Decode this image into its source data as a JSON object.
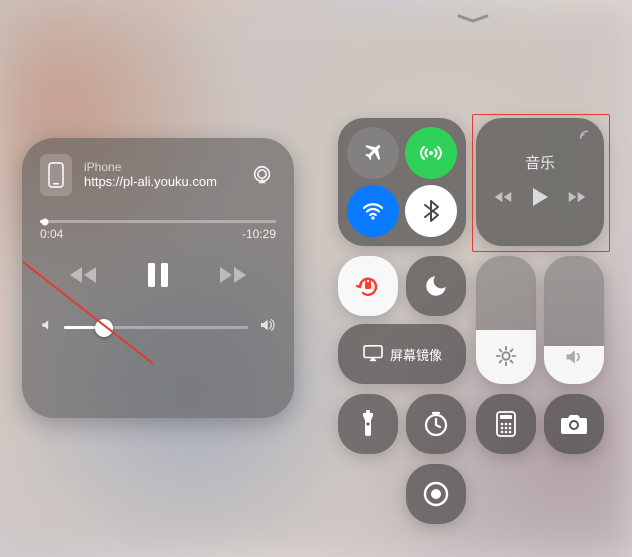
{
  "media": {
    "device_label": "iPhone",
    "now_playing_url": "https://pl-ali.youku.com",
    "elapsed": "0:04",
    "remaining": "-10:29"
  },
  "control_center": {
    "music_tile_title": "音乐",
    "screen_mirroring_label": "屏幕镜像"
  }
}
